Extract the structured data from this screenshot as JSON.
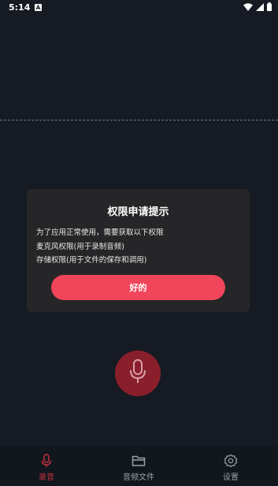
{
  "status_bar": {
    "time": "5:14"
  },
  "dialog": {
    "title": "权限申请提示",
    "lines": [
      "为了应用正常使用，需要获取以下权限",
      "麦克风权限(用于录制音频)",
      "存储权限(用于文件的保存和调用)"
    ],
    "ok_label": "好的"
  },
  "bottom_nav": {
    "items": [
      {
        "label": "录音",
        "icon": "microphone-icon",
        "active": true
      },
      {
        "label": "音频文件",
        "icon": "folder-icon",
        "active": false
      },
      {
        "label": "设置",
        "icon": "gear-icon",
        "active": false
      }
    ]
  },
  "colors": {
    "background": "#161a22",
    "dialog": "#262628",
    "accent": "#f0455a",
    "record_button": "#8a1f2c",
    "nav_active": "#c4313f",
    "nav_inactive": "#9a9ea6"
  }
}
